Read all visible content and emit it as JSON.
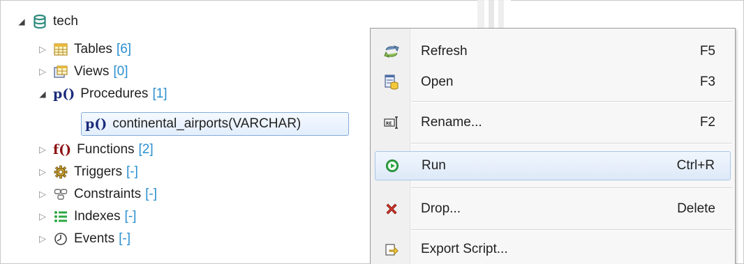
{
  "tree": {
    "root": {
      "label": "tech"
    },
    "items": [
      {
        "label": "Tables",
        "count": "[6]"
      },
      {
        "label": "Views",
        "count": "[0]"
      },
      {
        "label": "Procedures",
        "count": "[1]",
        "prefix": "p()"
      },
      {
        "label": "continental_airports(VARCHAR)",
        "prefix": "p()"
      },
      {
        "label": "Functions",
        "count": "[2]",
        "prefix": "f()"
      },
      {
        "label": "Triggers",
        "count": "[-]"
      },
      {
        "label": "Constraints",
        "count": "[-]"
      },
      {
        "label": "Indexes",
        "count": "[-]"
      },
      {
        "label": "Events",
        "count": "[-]"
      }
    ]
  },
  "menu": {
    "items": [
      {
        "label": "Refresh",
        "shortcut": "F5",
        "icon": "refresh-icon"
      },
      {
        "label": "Open",
        "shortcut": "F3",
        "icon": "open-icon"
      },
      {
        "label": "Rename...",
        "shortcut": "F2",
        "icon": "rename-icon"
      },
      {
        "label": "Run",
        "shortcut": "Ctrl+R",
        "icon": "run-icon"
      },
      {
        "label": "Drop...",
        "shortcut": "Delete",
        "icon": "drop-icon"
      },
      {
        "label": "Export Script...",
        "shortcut": "",
        "icon": "export-script-icon"
      }
    ],
    "highlighted": "Run"
  },
  "colors": {
    "count_blue": "#2a8fd0",
    "database_teal": "#2c8a7c",
    "run_green": "#2da843",
    "drop_red": "#c8322a",
    "selection_border": "#84acd9"
  }
}
